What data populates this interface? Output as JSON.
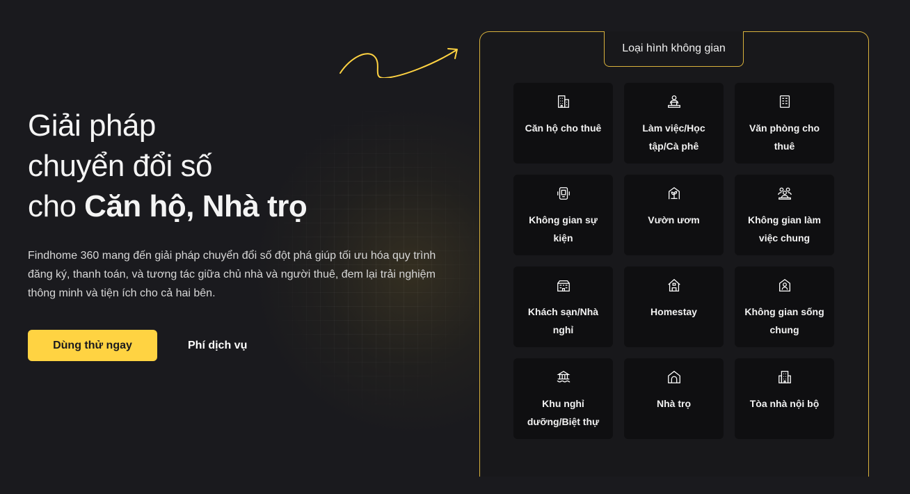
{
  "hero": {
    "title_line1": "Giải pháp",
    "title_line2": "chuyển đổi số",
    "title_line3_prefix": "cho ",
    "title_line3_bold": "Căn hộ, Nhà trọ",
    "description": "Findhome 360 mang đến giải pháp chuyển đổi số đột phá giúp tối ưu hóa quy trình đăng ký, thanh toán, và tương tác giữa chủ nhà và người thuê, đem lại trải nghiệm thông minh và tiện ích cho cả hai bên.",
    "primary_button": "Dùng thử ngay",
    "secondary_link": "Phí dịch vụ"
  },
  "panel": {
    "tab_label": "Loại hình không gian",
    "cards": [
      {
        "label": "Căn hộ cho thuê",
        "icon": "apartment-building-icon"
      },
      {
        "label": "Làm việc/Học tập/Cà phê",
        "icon": "person-at-desk-icon"
      },
      {
        "label": "Văn phòng cho thuê",
        "icon": "office-document-icon"
      },
      {
        "label": "Không gian sự kiện",
        "icon": "event-stage-icon"
      },
      {
        "label": "Vườn ươm",
        "icon": "sprout-icon"
      },
      {
        "label": "Không gian làm việc chung",
        "icon": "coworking-people-icon"
      },
      {
        "label": "Khách sạn/Nhà nghỉ",
        "icon": "hotel-icon"
      },
      {
        "label": "Homestay",
        "icon": "house-icon"
      },
      {
        "label": "Không gian sống chung",
        "icon": "coliving-house-icon"
      },
      {
        "label": "Khu nghỉ dưỡng/Biệt thự",
        "icon": "resort-icon"
      },
      {
        "label": "Nhà trọ",
        "icon": "arch-house-icon"
      },
      {
        "label": "Tòa nhà nội bộ",
        "icon": "internal-building-icon"
      }
    ]
  },
  "colors": {
    "accent": "#ffd342",
    "border": "#d9b23c",
    "background": "#1a1a1e",
    "card": "#0f0f11"
  }
}
